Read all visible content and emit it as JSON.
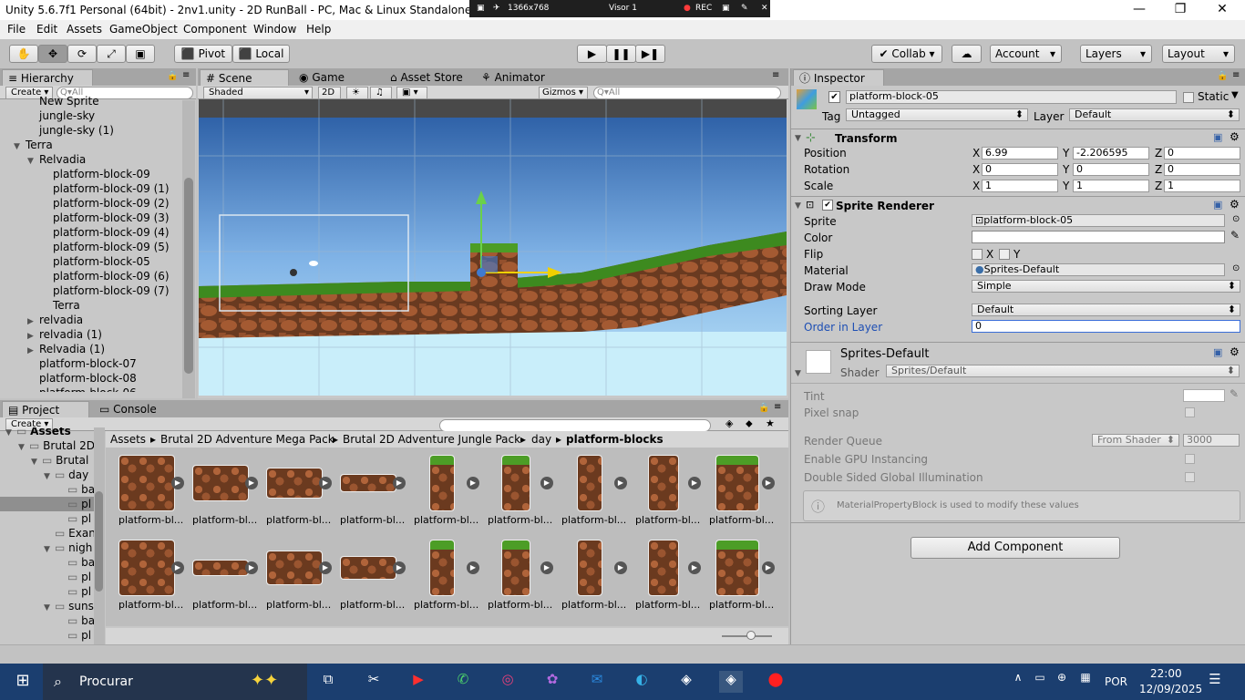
{
  "window": {
    "title": "Unity 5.6.7f1 Personal (64bit) - 2nv1.unity - 2D RunBall - PC, Mac & Linux Standalone* <DX11"
  },
  "recorder": {
    "resolution": "1366x768",
    "viewer": "Visor 1",
    "rec": "REC"
  },
  "menu": [
    "File",
    "Edit",
    "Assets",
    "GameObject",
    "Component",
    "Window",
    "Help"
  ],
  "toolbar": {
    "pivot": "Pivot",
    "local": "Local",
    "collab": "Collab",
    "account": "Account",
    "layers": "Layers",
    "layout": "Layout"
  },
  "hierarchy": {
    "tab": "Hierarchy",
    "create": "Create",
    "search_placeholder": "Q▾All",
    "items": [
      {
        "label": "New Sprite",
        "indent": 2,
        "arrow": ""
      },
      {
        "label": "jungle-sky",
        "indent": 2,
        "arrow": ""
      },
      {
        "label": "jungle-sky (1)",
        "indent": 2,
        "arrow": ""
      },
      {
        "label": "Terra",
        "indent": 1,
        "arrow": "▼"
      },
      {
        "label": "Relvadia",
        "indent": 2,
        "arrow": "▼"
      },
      {
        "label": "platform-block-09",
        "indent": 3,
        "arrow": ""
      },
      {
        "label": "platform-block-09 (1)",
        "indent": 3,
        "arrow": ""
      },
      {
        "label": "platform-block-09 (2)",
        "indent": 3,
        "arrow": ""
      },
      {
        "label": "platform-block-09 (3)",
        "indent": 3,
        "arrow": ""
      },
      {
        "label": "platform-block-09 (4)",
        "indent": 3,
        "arrow": ""
      },
      {
        "label": "platform-block-09 (5)",
        "indent": 3,
        "arrow": ""
      },
      {
        "label": "platform-block-05",
        "indent": 3,
        "arrow": ""
      },
      {
        "label": "platform-block-09 (6)",
        "indent": 3,
        "arrow": ""
      },
      {
        "label": "platform-block-09 (7)",
        "indent": 3,
        "arrow": ""
      },
      {
        "label": "Terra",
        "indent": 3,
        "arrow": ""
      },
      {
        "label": "relvadia",
        "indent": 2,
        "arrow": "▶"
      },
      {
        "label": "relvadia (1)",
        "indent": 2,
        "arrow": "▶"
      },
      {
        "label": "Relvadia (1)",
        "indent": 2,
        "arrow": "▶"
      },
      {
        "label": "platform-block-07",
        "indent": 2,
        "arrow": ""
      },
      {
        "label": "platform-block-08",
        "indent": 2,
        "arrow": ""
      },
      {
        "label": "platform-block-06",
        "indent": 2,
        "arrow": ""
      }
    ]
  },
  "scene": {
    "tabs": [
      "Scene",
      "Game",
      "Asset Store",
      "Animator"
    ],
    "shading": "Shaded",
    "mode2d": "2D",
    "gizmos": "Gizmos",
    "search_placeholder": "Q▾All"
  },
  "project": {
    "tabs": [
      "Project",
      "Console"
    ],
    "create": "Create",
    "breadcrumb": [
      "Assets",
      "Brutal 2D Adventure Mega Pack",
      "Brutal 2D Adventure Jungle Pack",
      "day",
      "platform-blocks"
    ],
    "tree": [
      {
        "label": "Assets",
        "arrow": "▼",
        "indent": 0
      },
      {
        "label": "Brutal 2D",
        "arrow": "▼",
        "indent": 1
      },
      {
        "label": "Brutal",
        "arrow": "▼",
        "indent": 2
      },
      {
        "label": "day",
        "arrow": "▼",
        "indent": 3
      },
      {
        "label": "ba",
        "arrow": "",
        "indent": 4
      },
      {
        "label": "pl",
        "arrow": "",
        "indent": 4
      },
      {
        "label": "pl",
        "arrow": "",
        "indent": 4
      },
      {
        "label": "Exan",
        "arrow": "",
        "indent": 3
      },
      {
        "label": "nigh",
        "arrow": "▼",
        "indent": 3
      },
      {
        "label": "ba",
        "arrow": "",
        "indent": 4
      },
      {
        "label": "pl",
        "arrow": "",
        "indent": 4
      },
      {
        "label": "pl",
        "arrow": "",
        "indent": 4
      },
      {
        "label": "suns",
        "arrow": "▼",
        "indent": 3
      },
      {
        "label": "ba",
        "arrow": "",
        "indent": 4
      },
      {
        "label": "pl",
        "arrow": "",
        "indent": 4
      }
    ],
    "thumb_label": "platform-bl...",
    "row1": [
      "platform-bl...",
      "platform-bl...",
      "platform-bl...",
      "platform-bl...",
      "platform-bl...",
      "platform-bl...",
      "platform-bl...",
      "platform-bl...",
      "platform-bl..."
    ],
    "row2": [
      "platform-bl...",
      "platform-bl...",
      "platform-bl...",
      "platform-bl...",
      "platform-bl...",
      "platform-bl...",
      "platform-bl...",
      "platform-bl...",
      "platform-bl..."
    ]
  },
  "inspector": {
    "tab": "Inspector",
    "object_name": "platform-block-05",
    "static_label": "Static",
    "tag_label": "Tag",
    "tag_value": "Untagged",
    "layer_label": "Layer",
    "layer_value": "Default",
    "transform": {
      "title": "Transform",
      "position": {
        "label": "Position",
        "x": "6.99",
        "y": "-2.206595",
        "z": "0"
      },
      "rotation": {
        "label": "Rotation",
        "x": "0",
        "y": "0",
        "z": "0"
      },
      "scale": {
        "label": "Scale",
        "x": "1",
        "y": "1",
        "z": "1"
      }
    },
    "sprite_renderer": {
      "title": "Sprite Renderer",
      "sprite_label": "Sprite",
      "sprite_value": "platform-block-05",
      "color_label": "Color",
      "flip_label": "Flip",
      "flip_x": "X",
      "flip_y": "Y",
      "material_label": "Material",
      "material_value": "Sprites-Default",
      "draw_mode_label": "Draw Mode",
      "draw_mode_value": "Simple",
      "sorting_layer_label": "Sorting Layer",
      "sorting_layer_value": "Default",
      "order_label": "Order in Layer",
      "order_value": "0"
    },
    "material": {
      "name": "Sprites-Default",
      "shader_label": "Shader",
      "shader_value": "Sprites/Default",
      "tint_label": "Tint",
      "pixel_snap_label": "Pixel snap",
      "render_queue_label": "Render Queue",
      "render_queue_mode": "From Shader",
      "render_queue_value": "3000",
      "gpu_label": "Enable GPU Instancing",
      "dsgi_label": "Double Sided Global Illumination",
      "info": "MaterialPropertyBlock is used to modify these values"
    },
    "add_component": "Add Component"
  },
  "taskbar": {
    "search": "Procurar",
    "lang": "POR",
    "time": "22:00",
    "date": "12/09/2025"
  }
}
